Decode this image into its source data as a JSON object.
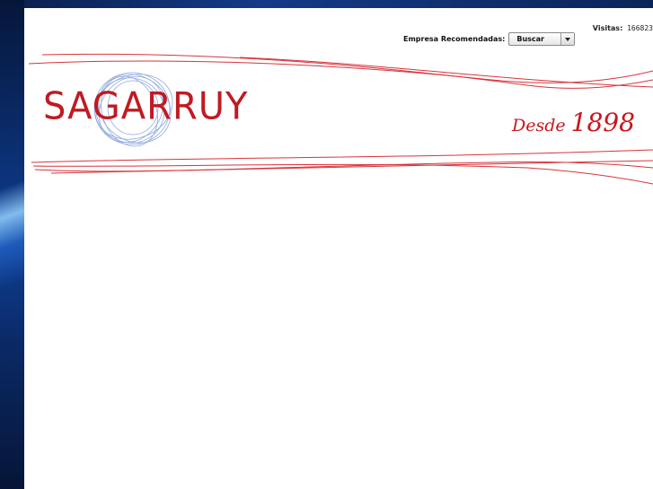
{
  "header": {
    "visits_label": "Visitas:",
    "visits_count": "166823",
    "recommend_label": "Empresa Recomendadas:",
    "select_value": "Buscar",
    "logo_text": "SAGARRUY",
    "since_word": "Desde",
    "since_year": "1898"
  },
  "colors": {
    "accent": "#c8161d",
    "scribble": "#6f8fcf",
    "background": "#0b2e6f"
  }
}
